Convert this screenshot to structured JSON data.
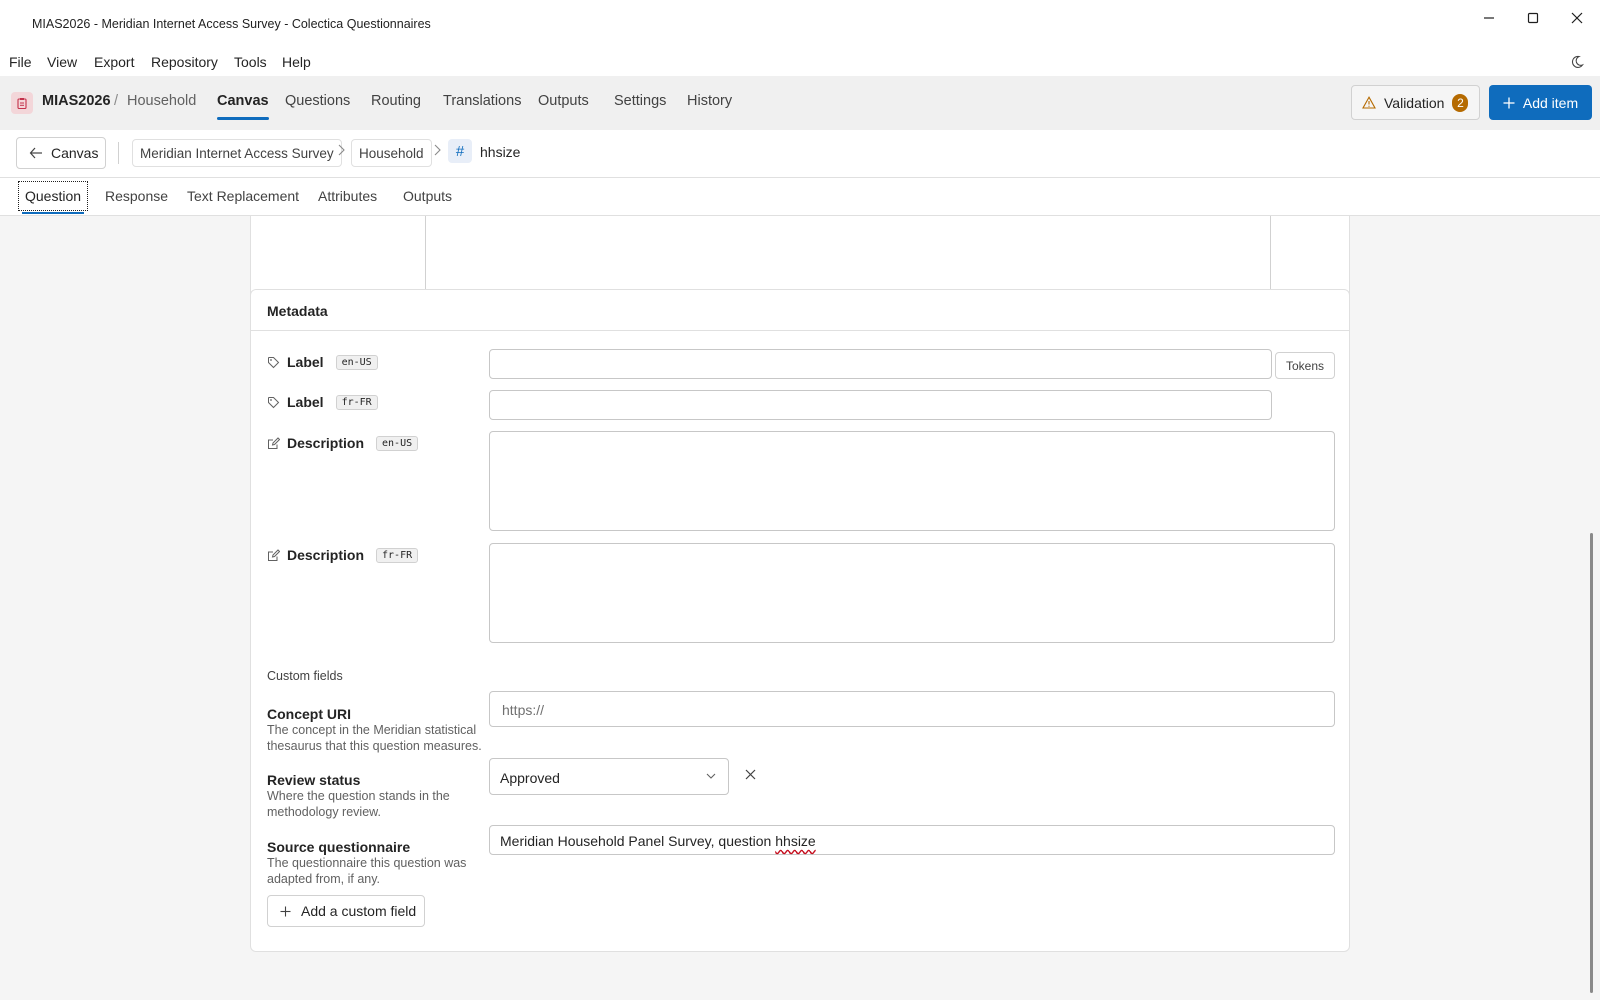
{
  "window": {
    "title": "MIAS2026 - Meridian Internet Access Survey - Colectica Questionnaires"
  },
  "menu": [
    "File",
    "View",
    "Export",
    "Repository",
    "Tools",
    "Help"
  ],
  "appbar": {
    "project": "MIAS2026",
    "separator": "/",
    "section": "Household",
    "tabs": [
      "Canvas",
      "Questions",
      "Routing",
      "Translations",
      "Outputs",
      "Settings",
      "History"
    ],
    "active_tab": "Canvas",
    "validation_label": "Validation",
    "validation_count": "2",
    "add_item_label": "Add item"
  },
  "breadcrumb": {
    "back_label": "Canvas",
    "items": [
      "Meridian Internet Access Survey",
      "Household"
    ],
    "current_symbol": "#",
    "current": "hhsize"
  },
  "subtabs": [
    "Question",
    "Response",
    "Text Replacement",
    "Attributes",
    "Outputs"
  ],
  "metadata": {
    "heading": "Metadata",
    "fields": [
      {
        "label": "Label",
        "lang": "en-US",
        "value": ""
      },
      {
        "label": "Label",
        "lang": "fr-FR",
        "value": ""
      },
      {
        "label": "Description",
        "lang": "en-US",
        "value": ""
      },
      {
        "label": "Description",
        "lang": "fr-FR",
        "value": ""
      }
    ],
    "tokens_label": "Tokens"
  },
  "custom_fields": {
    "title": "Custom fields",
    "concept": {
      "name": "Concept URI",
      "help": "The concept in the Meridian statistical thesaurus that this question measures.",
      "placeholder": "https://",
      "value": ""
    },
    "review": {
      "name": "Review status",
      "help": "Where the question stands in the methodology review.",
      "value": "Approved"
    },
    "source": {
      "name": "Source questionnaire",
      "help": "The questionnaire this question was adapted from, if any.",
      "value_prefix": "Meridian Household Panel Survey, question ",
      "value_word": "hhsize"
    },
    "add_label": "Add a custom field"
  },
  "colors": {
    "accent": "#0f6cbd",
    "badge": "#b56a00",
    "spell_error": "#c50f1f"
  }
}
